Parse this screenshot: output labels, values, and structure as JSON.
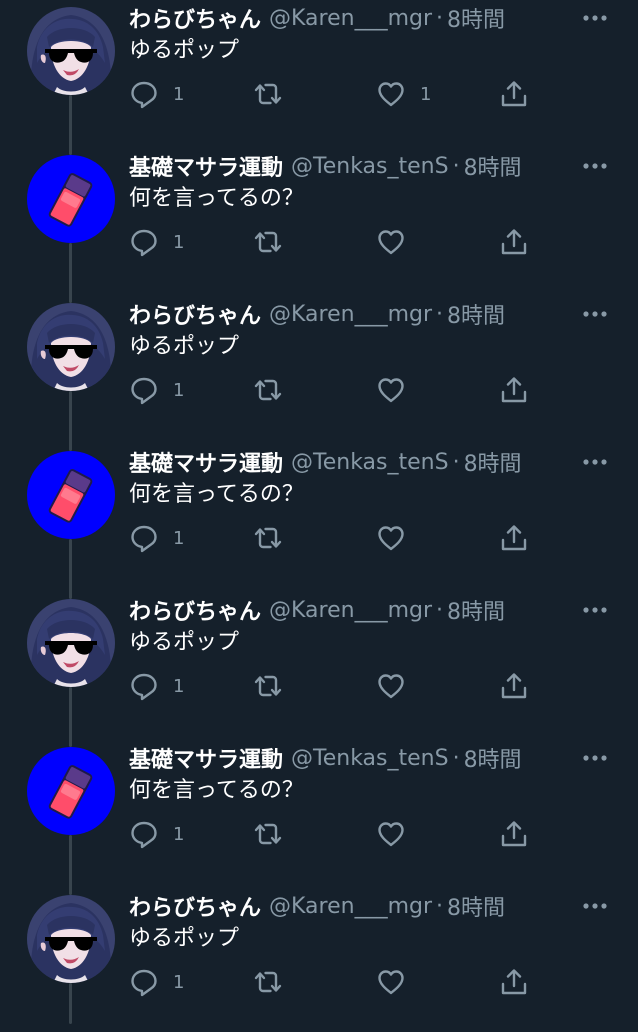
{
  "colors": {
    "background": "#15202b",
    "secondary_text": "#8899a6",
    "thread_line": "#38444d",
    "icon": "#8899a6",
    "avatar_blue": "#0000ff"
  },
  "tweets": [
    {
      "name": "わらびちゃん",
      "handle": "@Karen___mgr",
      "dot": "·",
      "time": "8時間",
      "text": "ゆるポップ",
      "reply_count": "1",
      "like_count": "1",
      "avatar": "sunglasses-girl"
    },
    {
      "name": "基礎マサラ運動",
      "handle": "@Tenkas_tenS",
      "dot": "·",
      "time": "8時間",
      "text": "何を言ってるの？",
      "reply_count": "1",
      "like_count": "",
      "avatar": "blue-eraser"
    },
    {
      "name": "わらびちゃん",
      "handle": "@Karen___mgr",
      "dot": "·",
      "time": "8時間",
      "text": "ゆるポップ",
      "reply_count": "1",
      "like_count": "",
      "avatar": "sunglasses-girl"
    },
    {
      "name": "基礎マサラ運動",
      "handle": "@Tenkas_tenS",
      "dot": "·",
      "time": "8時間",
      "text": "何を言ってるの？",
      "reply_count": "1",
      "like_count": "",
      "avatar": "blue-eraser"
    },
    {
      "name": "わらびちゃん",
      "handle": "@Karen___mgr",
      "dot": "·",
      "time": "8時間",
      "text": "ゆるポップ",
      "reply_count": "1",
      "like_count": "",
      "avatar": "sunglasses-girl"
    },
    {
      "name": "基礎マサラ運動",
      "handle": "@Tenkas_tenS",
      "dot": "·",
      "time": "8時間",
      "text": "何を言ってるの？",
      "reply_count": "1",
      "like_count": "",
      "avatar": "blue-eraser"
    },
    {
      "name": "わらびちゃん",
      "handle": "@Karen___mgr",
      "dot": "·",
      "time": "8時間",
      "text": "ゆるポップ",
      "reply_count": "1",
      "like_count": "",
      "avatar": "sunglasses-girl"
    }
  ]
}
